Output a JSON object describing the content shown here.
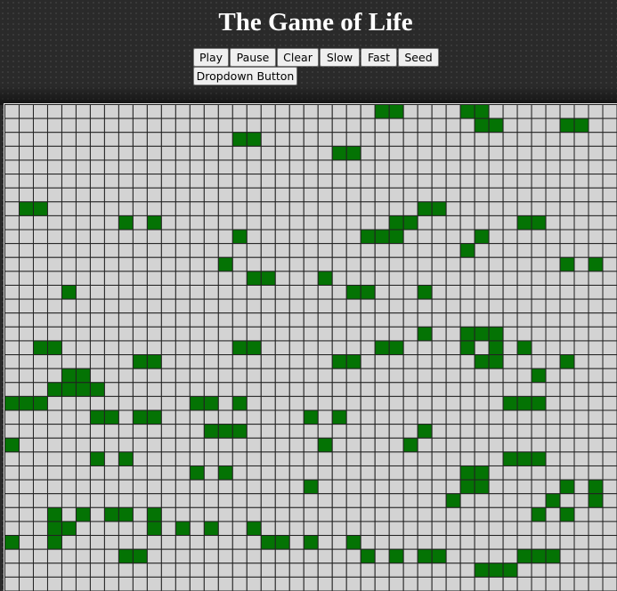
{
  "title": "The Game of Life",
  "buttons": {
    "play": "Play",
    "pause": "Pause",
    "clear": "Clear",
    "slow": "Slow",
    "fast": "Fast",
    "seed": "Seed",
    "dropdown": "Dropdown Button"
  },
  "colors": {
    "live_cell": "#047304",
    "dead_cell": "#d3d3d3",
    "grid_line": "#222222",
    "background": "#2a2a2a"
  },
  "board": {
    "live_cells": [
      [
        0,
        26
      ],
      [
        0,
        27
      ],
      [
        0,
        32
      ],
      [
        0,
        33
      ],
      [
        1,
        33
      ],
      [
        1,
        34
      ],
      [
        1,
        39
      ],
      [
        1,
        40
      ],
      [
        2,
        16
      ],
      [
        2,
        17
      ],
      [
        3,
        23
      ],
      [
        3,
        24
      ],
      [
        7,
        1
      ],
      [
        7,
        2
      ],
      [
        7,
        29
      ],
      [
        7,
        30
      ],
      [
        8,
        8
      ],
      [
        8,
        10
      ],
      [
        8,
        27
      ],
      [
        8,
        28
      ],
      [
        8,
        36
      ],
      [
        8,
        37
      ],
      [
        9,
        16
      ],
      [
        9,
        25
      ],
      [
        9,
        26
      ],
      [
        9,
        27
      ],
      [
        9,
        33
      ],
      [
        10,
        32
      ],
      [
        11,
        15
      ],
      [
        11,
        39
      ],
      [
        11,
        41
      ],
      [
        12,
        17
      ],
      [
        12,
        18
      ],
      [
        12,
        22
      ],
      [
        13,
        4
      ],
      [
        13,
        24
      ],
      [
        13,
        25
      ],
      [
        13,
        29
      ],
      [
        16,
        29
      ],
      [
        16,
        32
      ],
      [
        16,
        33
      ],
      [
        16,
        34
      ],
      [
        17,
        2
      ],
      [
        17,
        3
      ],
      [
        17,
        16
      ],
      [
        17,
        17
      ],
      [
        17,
        26
      ],
      [
        17,
        27
      ],
      [
        17,
        32
      ],
      [
        17,
        34
      ],
      [
        17,
        36
      ],
      [
        18,
        9
      ],
      [
        18,
        10
      ],
      [
        18,
        23
      ],
      [
        18,
        24
      ],
      [
        18,
        33
      ],
      [
        18,
        34
      ],
      [
        18,
        39
      ],
      [
        19,
        4
      ],
      [
        19,
        5
      ],
      [
        19,
        37
      ],
      [
        20,
        3
      ],
      [
        20,
        4
      ],
      [
        20,
        5
      ],
      [
        20,
        6
      ],
      [
        21,
        0
      ],
      [
        21,
        1
      ],
      [
        21,
        2
      ],
      [
        21,
        13
      ],
      [
        21,
        14
      ],
      [
        21,
        16
      ],
      [
        21,
        35
      ],
      [
        21,
        36
      ],
      [
        21,
        37
      ],
      [
        22,
        6
      ],
      [
        22,
        7
      ],
      [
        22,
        9
      ],
      [
        22,
        10
      ],
      [
        22,
        21
      ],
      [
        22,
        23
      ],
      [
        23,
        14
      ],
      [
        23,
        15
      ],
      [
        23,
        16
      ],
      [
        23,
        29
      ],
      [
        24,
        0
      ],
      [
        24,
        22
      ],
      [
        24,
        28
      ],
      [
        25,
        6
      ],
      [
        25,
        8
      ],
      [
        25,
        35
      ],
      [
        25,
        36
      ],
      [
        25,
        37
      ],
      [
        26,
        13
      ],
      [
        26,
        15
      ],
      [
        26,
        32
      ],
      [
        26,
        33
      ],
      [
        27,
        21
      ],
      [
        27,
        32
      ],
      [
        27,
        33
      ],
      [
        27,
        39
      ],
      [
        27,
        41
      ],
      [
        28,
        31
      ],
      [
        28,
        38
      ],
      [
        28,
        41
      ],
      [
        29,
        3
      ],
      [
        29,
        5
      ],
      [
        29,
        7
      ],
      [
        29,
        8
      ],
      [
        29,
        10
      ],
      [
        29,
        37
      ],
      [
        29,
        39
      ],
      [
        30,
        3
      ],
      [
        30,
        4
      ],
      [
        30,
        10
      ],
      [
        30,
        12
      ],
      [
        30,
        14
      ],
      [
        30,
        17
      ],
      [
        31,
        0
      ],
      [
        31,
        3
      ],
      [
        31,
        18
      ],
      [
        31,
        19
      ],
      [
        31,
        21
      ],
      [
        31,
        24
      ],
      [
        32,
        8
      ],
      [
        32,
        9
      ],
      [
        32,
        25
      ],
      [
        32,
        27
      ],
      [
        32,
        29
      ],
      [
        32,
        30
      ],
      [
        32,
        36
      ],
      [
        32,
        37
      ],
      [
        32,
        38
      ],
      [
        33,
        33
      ],
      [
        33,
        34
      ],
      [
        33,
        35
      ]
    ]
  }
}
